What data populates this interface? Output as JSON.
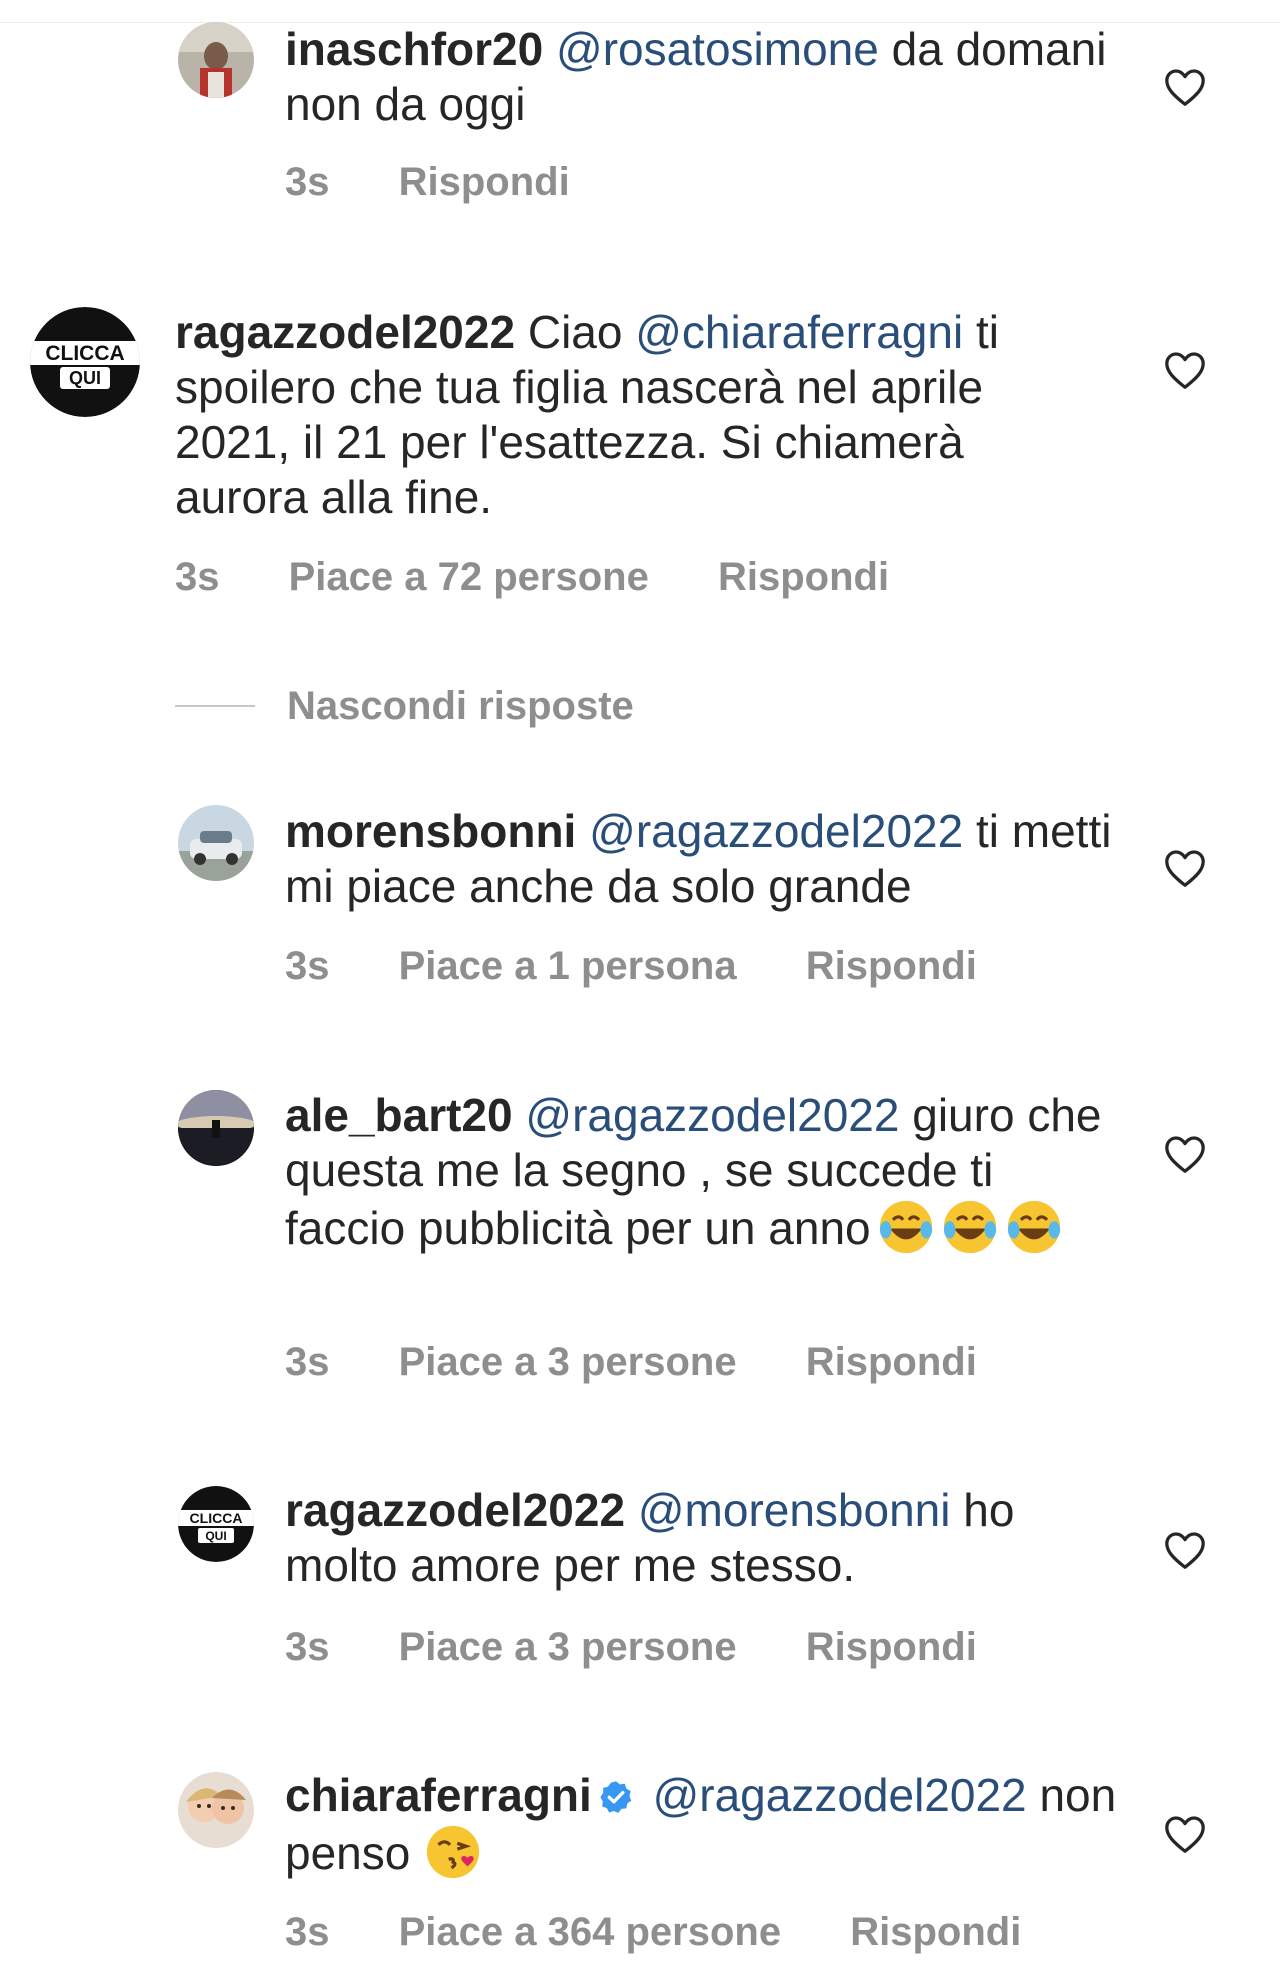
{
  "comments": [
    {
      "username": "inaschfor20",
      "mention": "@rosatosimone",
      "text": "da domani non da oggi",
      "time": "3s",
      "likes": "",
      "reply_label": "Rispondi",
      "avatar_icon": "user-photo-avatar"
    },
    {
      "username": "ragazzodel2022",
      "pre_text": "Ciao",
      "mention": "@chiaraferragni",
      "text": "ti spoilero che tua figlia nascerà nel aprile 2021, il 21 per l'esattezza. Si chiamerà aurora alla fine.",
      "time": "3s",
      "likes": "Piace a 72 persone",
      "reply_label": "Rispondi",
      "avatar_text_top": "CLICCA",
      "avatar_text_bottom": "QUI"
    },
    {
      "username": "morensbonni",
      "mention": "@ragazzodel2022",
      "text": "ti metti mi piace anche da solo grande",
      "time": "3s",
      "likes": "Piace a 1 persona",
      "reply_label": "Rispondi",
      "avatar_icon": "car-photo-avatar"
    },
    {
      "username": "ale_bart20",
      "mention": "@ragazzodel2022",
      "text": "giuro che questa me la segno , se succede ti faccio pubblicità per un anno",
      "emoji": "😂😂😂",
      "time": "3s",
      "likes": "Piace a 3 persone",
      "reply_label": "Rispondi",
      "avatar_icon": "sunset-photo-avatar"
    },
    {
      "username": "ragazzodel2022",
      "mention": "@morensbonni",
      "text": "ho molto amore per me stesso.",
      "time": "3s",
      "likes": "Piace a 3 persone",
      "reply_label": "Rispondi",
      "avatar_text_top": "CLICCA",
      "avatar_text_bottom": "QUI"
    },
    {
      "username": "chiaraferragni",
      "verified": true,
      "mention": "@ragazzodel2022",
      "text": "non penso",
      "emoji": "😘",
      "time": "3s",
      "likes": "Piace a 364 persone",
      "reply_label": "Rispondi",
      "avatar_icon": "child-photo-avatar"
    }
  ],
  "hide_replies_label": "Nascondi risposte",
  "colors": {
    "text": "#262626",
    "mention": "#2a4e7a",
    "meta": "#8e8e8e",
    "verified": "#3897f0"
  }
}
